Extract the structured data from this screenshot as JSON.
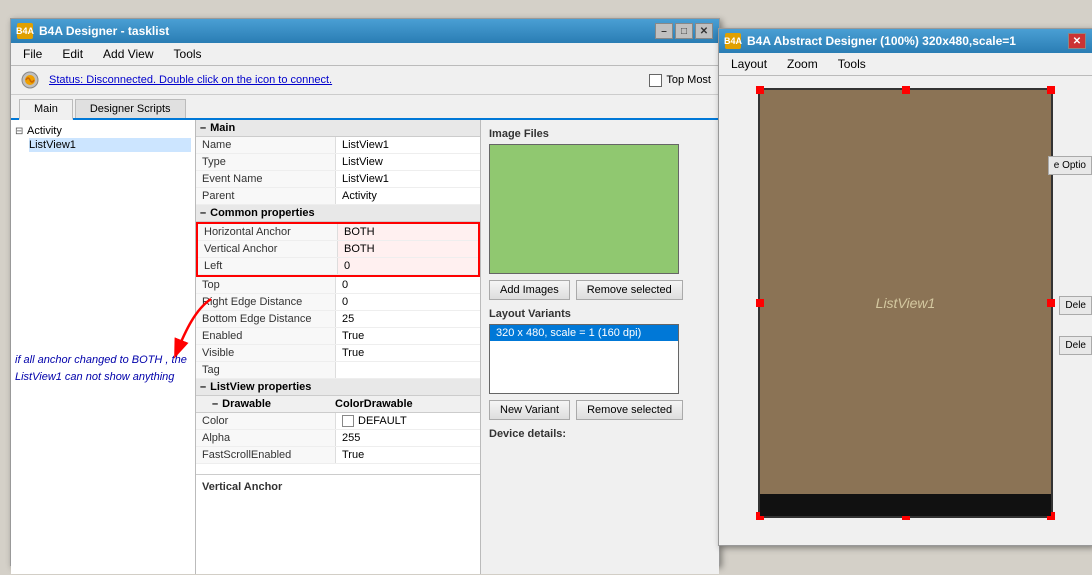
{
  "mainWindow": {
    "title": "B4A Designer - tasklist",
    "statusText": "Status: Disconnected. Double click on the icon to connect.",
    "topMostLabel": "Top Most",
    "tabs": [
      "Main",
      "Designer Scripts"
    ],
    "activeTab": "Main",
    "menuItems": [
      "File",
      "Edit",
      "Add View",
      "Tools"
    ]
  },
  "tree": {
    "items": [
      {
        "label": "Activity",
        "indent": 0,
        "expanded": true
      },
      {
        "label": "ListView1",
        "indent": 1,
        "selected": true
      }
    ]
  },
  "properties": {
    "sections": [
      {
        "name": "Main",
        "rows": [
          {
            "name": "Name",
            "value": "ListView1"
          },
          {
            "name": "Type",
            "value": "ListView"
          },
          {
            "name": "Event Name",
            "value": "ListView1"
          },
          {
            "name": "Parent",
            "value": "Activity"
          }
        ]
      },
      {
        "name": "Common properties",
        "rows": [
          {
            "name": "Horizontal Anchor",
            "value": "BOTH",
            "highlight": true
          },
          {
            "name": "Vertical Anchor",
            "value": "BOTH",
            "highlight": true
          },
          {
            "name": "Left",
            "value": "0",
            "highlight": true
          },
          {
            "name": "Top",
            "value": "0"
          },
          {
            "name": "Right Edge Distance",
            "value": "0"
          },
          {
            "name": "Bottom Edge Distance",
            "value": "25"
          },
          {
            "name": "Enabled",
            "value": "True"
          },
          {
            "name": "Visible",
            "value": "True"
          },
          {
            "name": "Tag",
            "value": ""
          }
        ]
      },
      {
        "name": "ListView properties",
        "rows": [
          {
            "name": "– Drawable",
            "value": ""
          },
          {
            "name": "Color",
            "value": "DEFAULT",
            "hasColorSwatch": true
          },
          {
            "name": "Alpha",
            "value": "255"
          },
          {
            "name": "FastScrollEnabled",
            "value": "True"
          }
        ]
      }
    ]
  },
  "rightPanel": {
    "imageFilesLabel": "Image Files",
    "addImagesBtn": "Add Images",
    "removeSelectedBtn1": "Remove selected",
    "layoutVariantsLabel": "Layout Variants",
    "variants": [
      "320 x 480, scale = 1 (160 dpi)"
    ],
    "newVariantBtn": "New Variant",
    "removeSelectedBtn2": "Remove selected",
    "deviceDetailsLabel": "Device details:"
  },
  "annotation": {
    "text": "if all anchor changed to BOTH , the ListView1 can not show anything"
  },
  "verticalAnchorLabel": "Vertical Anchor",
  "abstractWindow": {
    "title": "B4A Abstract Designer (100%) 320x480,scale=1",
    "menuItems": [
      "Layout",
      "Zoom",
      "Tools"
    ],
    "canvasLabel": "ListView1",
    "sideButtons": [
      "e Optio",
      "Dele",
      "Dele"
    ]
  }
}
